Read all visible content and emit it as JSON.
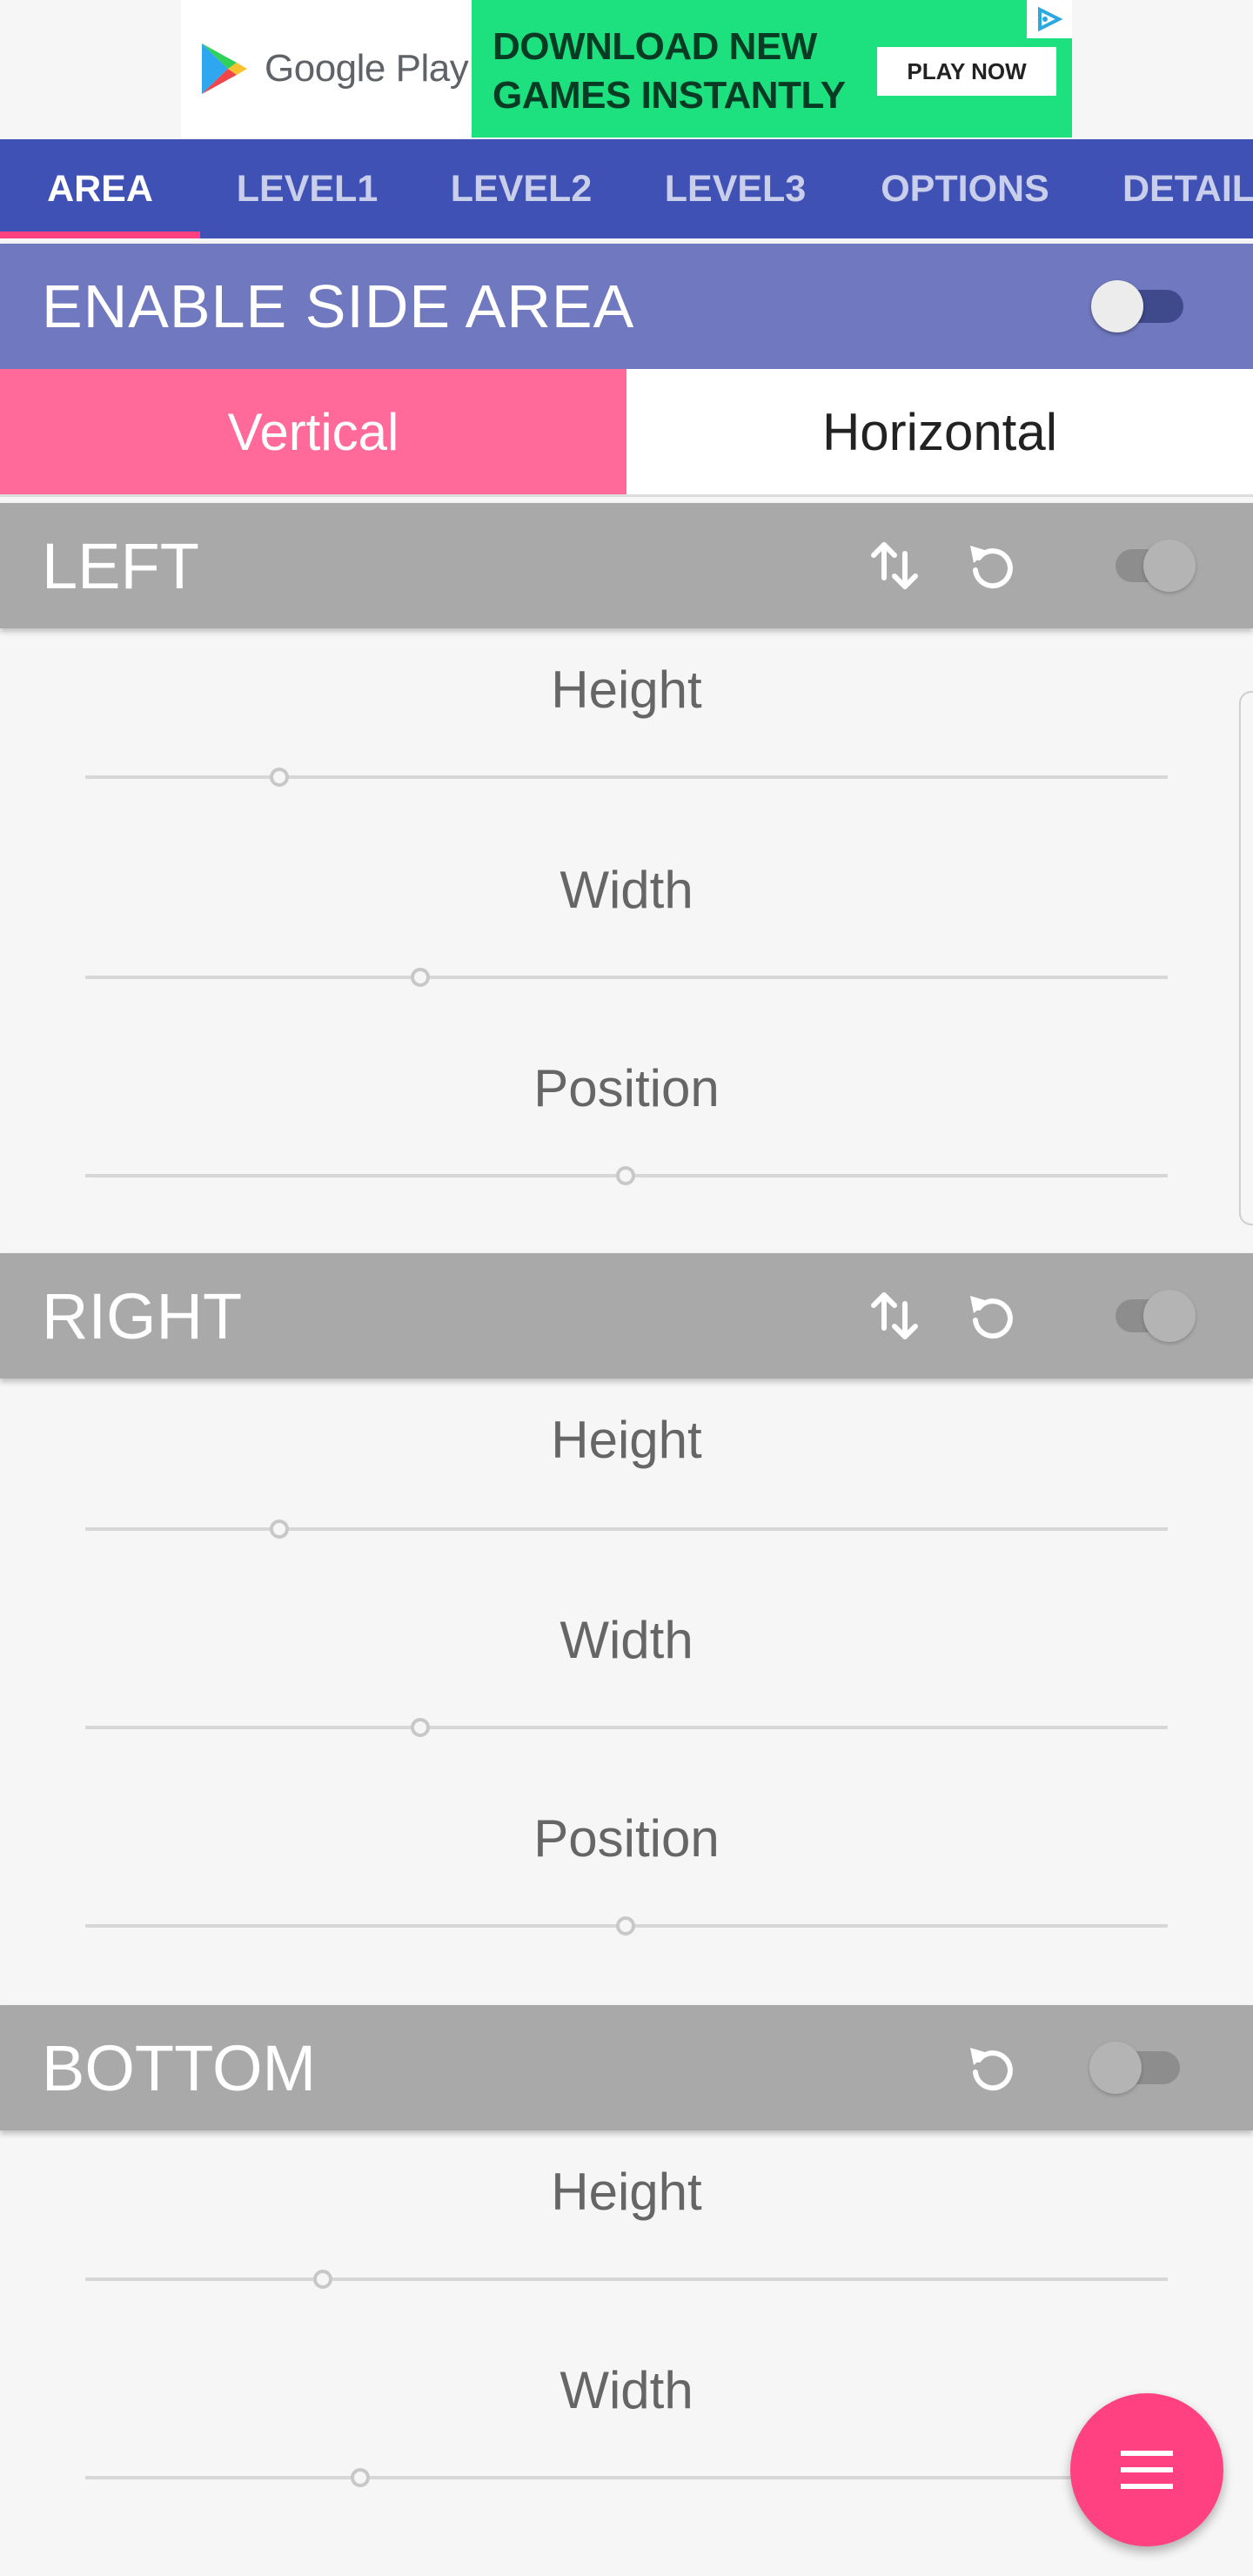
{
  "ad": {
    "store_label": "Google Play",
    "headline": "DOWNLOAD NEW GAMES INSTANTLY",
    "cta": "PLAY NOW",
    "colors": {
      "panel": "#1de07f",
      "headline": "#083b24"
    }
  },
  "tabs": [
    {
      "label": "AREA",
      "active": true
    },
    {
      "label": "LEVEL1",
      "active": false
    },
    {
      "label": "LEVEL2",
      "active": false
    },
    {
      "label": "LEVEL3",
      "active": false
    },
    {
      "label": "OPTIONS",
      "active": false
    },
    {
      "label": "DETAIL",
      "active": false
    }
  ],
  "enable_side_area": {
    "label": "ENABLE SIDE AREA",
    "enabled": false
  },
  "orientation": {
    "options": [
      "Vertical",
      "Horizontal"
    ],
    "selected": "Vertical"
  },
  "sections": {
    "left": {
      "title": "LEFT",
      "icons": [
        "swap-vert-icon",
        "reset-icon"
      ],
      "enabled": false,
      "sliders": [
        {
          "label": "Height",
          "value_fraction": 0.18
        },
        {
          "label": "Width",
          "value_fraction": 0.31
        },
        {
          "label": "Position",
          "value_fraction": 0.5
        }
      ]
    },
    "right": {
      "title": "RIGHT",
      "icons": [
        "swap-vert-icon",
        "reset-icon"
      ],
      "enabled": false,
      "sliders": [
        {
          "label": "Height",
          "value_fraction": 0.18
        },
        {
          "label": "Width",
          "value_fraction": 0.31
        },
        {
          "label": "Position",
          "value_fraction": 0.5
        }
      ]
    },
    "bottom": {
      "title": "BOTTOM",
      "icons": [
        "reset-icon"
      ],
      "enabled": false,
      "sliders": [
        {
          "label": "Height",
          "value_fraction": 0.22
        },
        {
          "label": "Width",
          "value_fraction": 0.255
        }
      ]
    }
  },
  "fab": {
    "icon": "menu-icon"
  },
  "colors": {
    "primary": "#3f51b5",
    "accent": "#ff4081",
    "enable_bar": "#7079bf",
    "selected_segment": "#ff6a9a",
    "section_bar": "#a9a9a9"
  }
}
